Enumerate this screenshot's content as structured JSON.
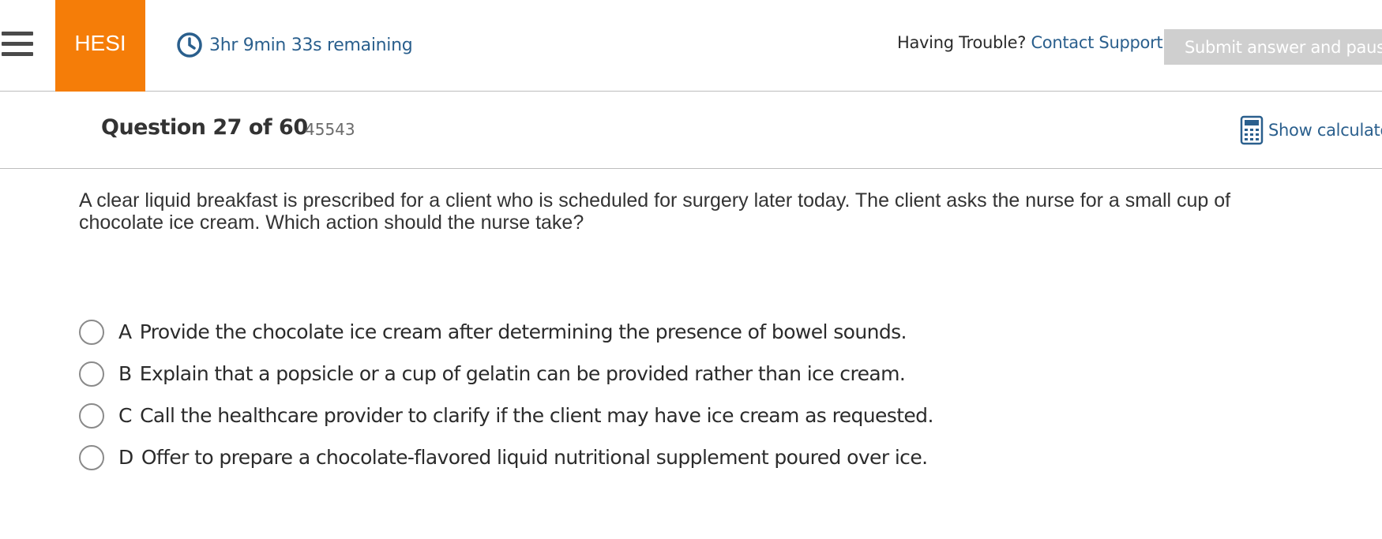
{
  "header": {
    "menu_icon": "hamburger-menu-icon",
    "brand": "HESI",
    "timer_icon": "clock-icon",
    "timer_text": "3hr 9min 33s remaining",
    "trouble_label": "Having Trouble?",
    "contact_link": "Contact Support",
    "submit_label": "Submit answer and pause/l"
  },
  "question_bar": {
    "number_label": "Question 27 of 60",
    "question_id": "45543",
    "calculator_icon": "calculator-icon",
    "calculator_label": "Show calculator"
  },
  "question": {
    "stem": "A clear liquid breakfast is prescribed for a client who is scheduled for surgery later today. The client asks the nurse for a small cup of chocolate ice cream. Which action should the nurse take?",
    "options": [
      {
        "letter": "A",
        "text": "Provide the chocolate ice cream after determining the presence of bowel sounds."
      },
      {
        "letter": "B",
        "text": "Explain that a popsicle or a cup of gelatin can be provided rather than ice cream."
      },
      {
        "letter": "C",
        "text": "Call the healthcare provider to clarify if the client may have ice cream as requested."
      },
      {
        "letter": "D",
        "text": "Offer to prepare a chocolate-flavored liquid nutritional supplement poured over ice."
      }
    ]
  },
  "colors": {
    "brand": "#f57d08",
    "link": "#2a5f8d",
    "submit_disabled": "#cfcfcf"
  }
}
